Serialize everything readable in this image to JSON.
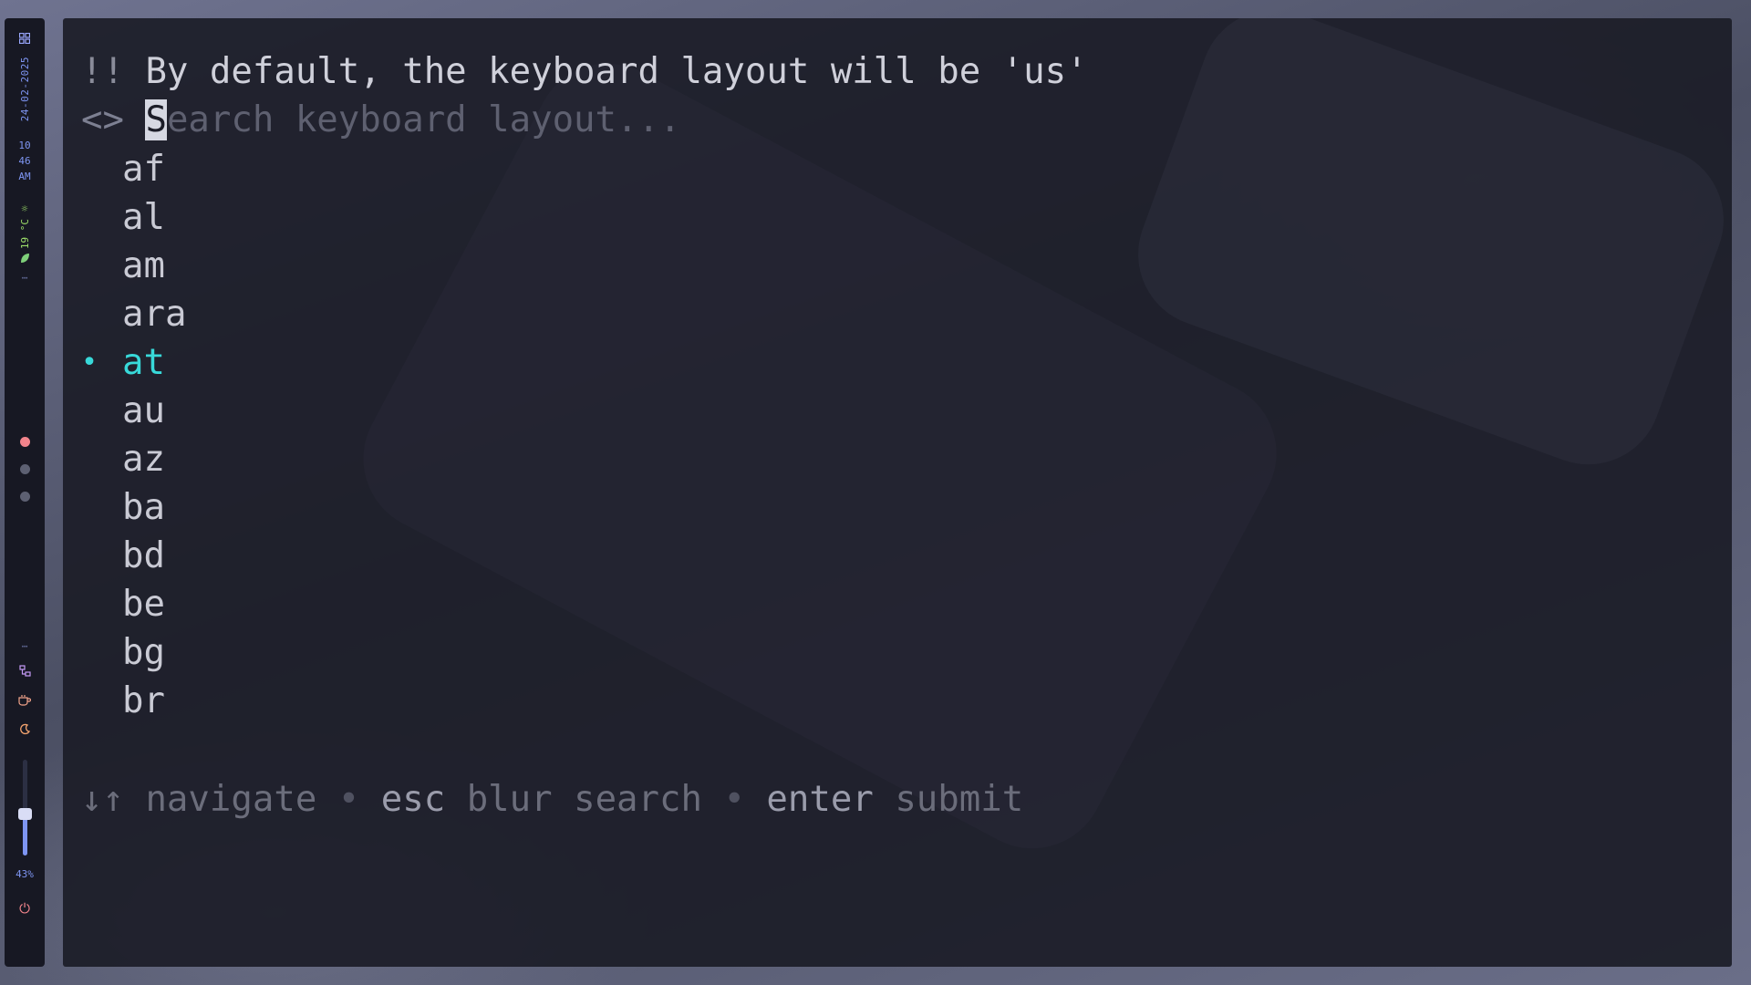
{
  "statusbar": {
    "date": "24-02-2025",
    "time_hour": "10",
    "time_minute": "46",
    "time_period": "AM",
    "weather_icon": "sun-icon",
    "temperature": "19 °C",
    "brightness_percent": "43%",
    "brightness_value": 0.43,
    "workspaces": [
      {
        "active": true
      },
      {
        "active": false
      },
      {
        "active": false
      }
    ]
  },
  "terminal": {
    "warning_bang": "!!",
    "warning_text": "By default, the keyboard layout will be 'us'",
    "search_prompt": "<>",
    "search_placeholder": "Search keyboard layout...",
    "search_cursor_char": "S",
    "search_placeholder_rest": "earch keyboard layout...",
    "selected_marker": "•",
    "options": [
      {
        "label": "af",
        "selected": false
      },
      {
        "label": "al",
        "selected": false
      },
      {
        "label": "am",
        "selected": false
      },
      {
        "label": "ara",
        "selected": false
      },
      {
        "label": "at",
        "selected": true
      },
      {
        "label": "au",
        "selected": false
      },
      {
        "label": "az",
        "selected": false
      },
      {
        "label": "ba",
        "selected": false
      },
      {
        "label": "bd",
        "selected": false
      },
      {
        "label": "be",
        "selected": false
      },
      {
        "label": "bg",
        "selected": false
      },
      {
        "label": "br",
        "selected": false
      }
    ],
    "help": {
      "arrows": "↓↑",
      "navigate": "navigate",
      "separator": "•",
      "esc_key": "esc",
      "esc_action": "blur search",
      "enter_key": "enter",
      "enter_action": "submit"
    }
  },
  "colors": {
    "accent_cyan": "#38d9d9",
    "bar_blue": "#7e95f2",
    "workspace_active": "#f2848c",
    "weather_green": "#9ee06a"
  }
}
